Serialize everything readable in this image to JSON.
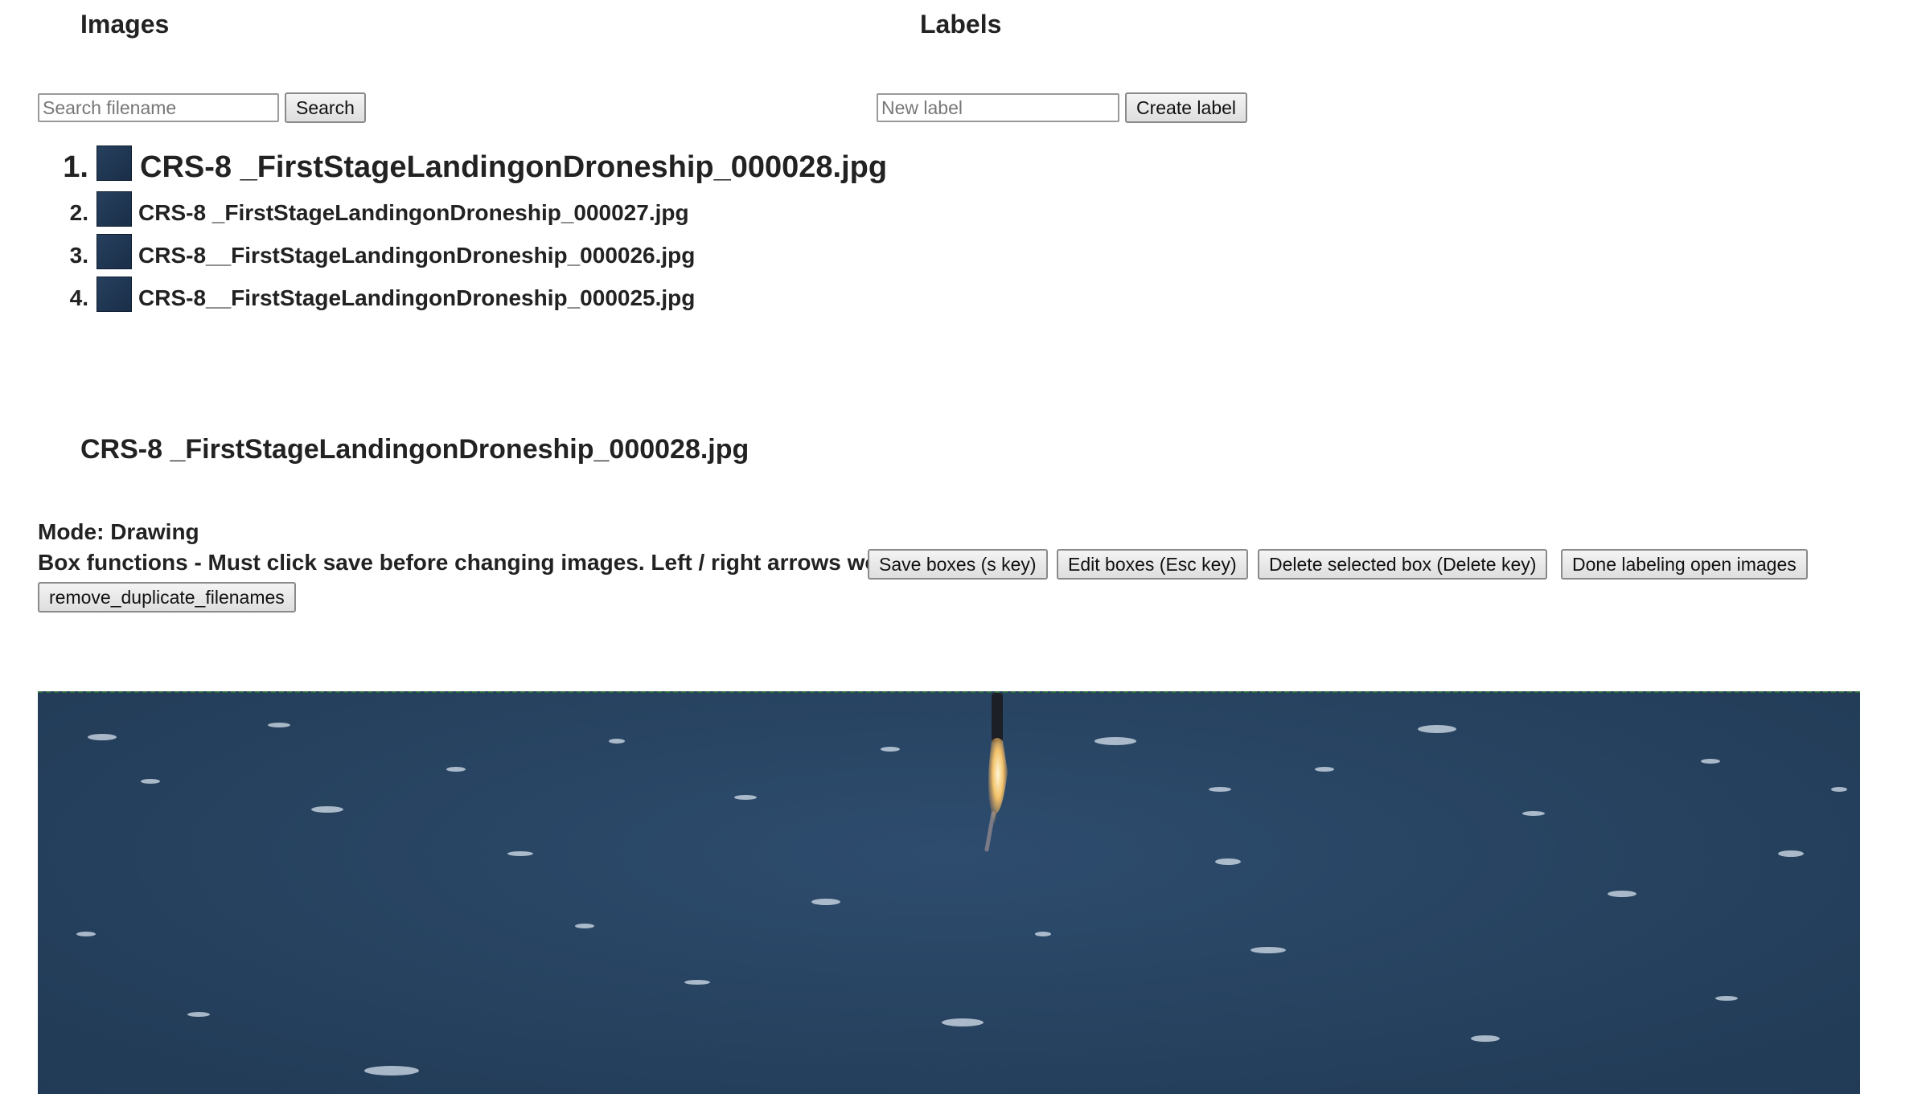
{
  "images_panel": {
    "title": "Images",
    "search_placeholder": "Search filename",
    "search_value": "",
    "search_button": "Search",
    "files": [
      {
        "index": "1.",
        "name": "CRS-8 _FirstStageLandingonDroneship_000028.jpg",
        "selected": true
      },
      {
        "index": "2.",
        "name": "CRS-8 _FirstStageLandingonDroneship_000027.jpg",
        "selected": false
      },
      {
        "index": "3.",
        "name": "CRS-8__FirstStageLandingonDroneship_000026.jpg",
        "selected": false
      },
      {
        "index": "4.",
        "name": "CRS-8__FirstStageLandingonDroneship_000025.jpg",
        "selected": false
      }
    ]
  },
  "labels_panel": {
    "title": "Labels",
    "new_label_placeholder": "New label",
    "new_label_value": "",
    "create_button": "Create label"
  },
  "current_image": {
    "filename": "CRS-8 _FirstStageLandingonDroneship_000028.jpg"
  },
  "controls": {
    "mode_text": "Mode: Drawing",
    "box_functions_text": "Box functions - Must click save before changing images. Left / right arrows work",
    "save_button": "Save boxes (s key)",
    "edit_button": "Edit boxes (Esc key)",
    "delete_button": "Delete selected box (Delete key)",
    "done_button": "Done labeling open images",
    "remove_dupes_button": "remove_duplicate_filenames"
  },
  "colors": {
    "ocean": "#26425f",
    "text": "#222222",
    "canvas_border": "#2f6b3a"
  }
}
